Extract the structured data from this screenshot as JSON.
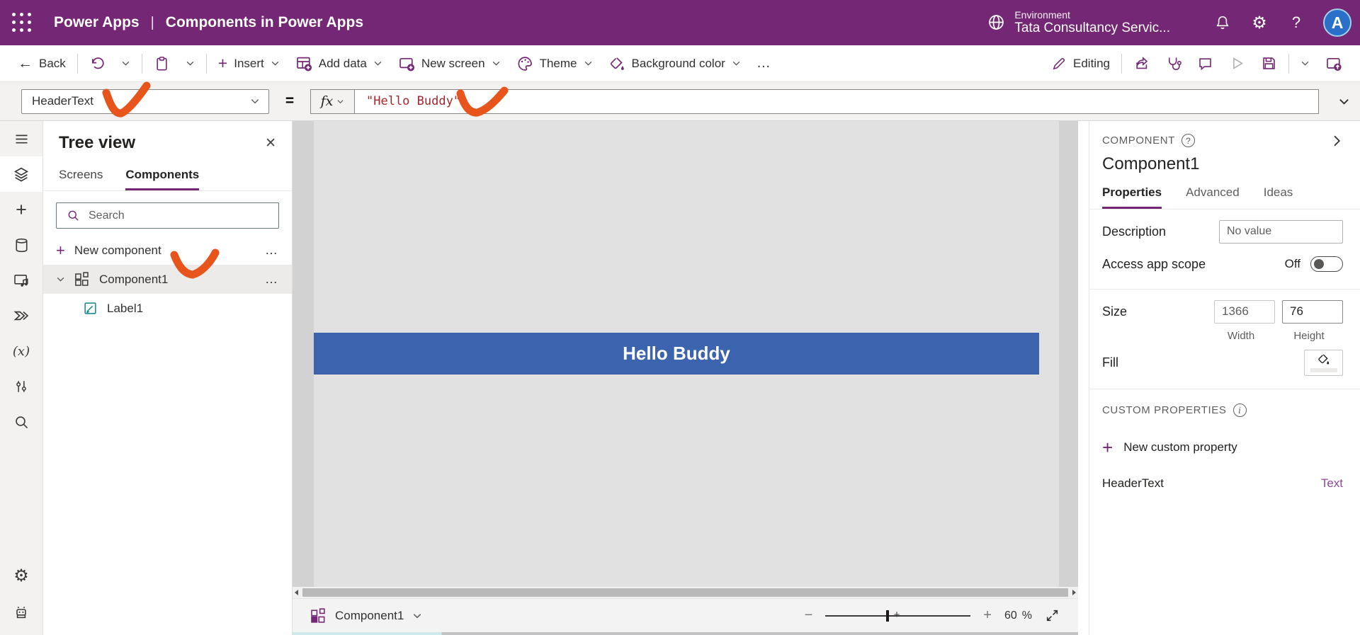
{
  "app": {
    "brand": "Power Apps",
    "title": "Components in Power Apps",
    "environment_label": "Environment",
    "environment_name": "Tata Consultancy Servic...",
    "avatar_initial": "A"
  },
  "glyphs": {
    "back_arrow": "←",
    "plus": "+",
    "ellipsis": "…",
    "minus": "−",
    "close": "✕",
    "gear": "⚙",
    "question_mark": "?",
    "info": "i",
    "pipe": "|",
    "x_variables": "(x)"
  },
  "toolbar": {
    "back": "Back",
    "insert": "Insert",
    "add_data": "Add data",
    "new_screen": "New screen",
    "theme": "Theme",
    "background_color": "Background color",
    "editing": "Editing"
  },
  "formula_bar": {
    "property": "HeaderText",
    "equals": "=",
    "fx": "fx",
    "formula": "\"Hello Buddy\""
  },
  "tree_view": {
    "title": "Tree view",
    "tabs": [
      "Screens",
      "Components"
    ],
    "search_placeholder": "Search",
    "new_component": "New component",
    "component": "Component1",
    "child": "Label1"
  },
  "canvas": {
    "component_text": "Hello Buddy"
  },
  "bottom_bar": {
    "component": "Component1",
    "zoom_value": "60",
    "zoom_unit": "%"
  },
  "right_panel": {
    "header": "COMPONENT",
    "name": "Component1",
    "tabs": [
      "Properties",
      "Advanced",
      "Ideas"
    ],
    "description_label": "Description",
    "description_placeholder": "No value",
    "access_label": "Access app scope",
    "access_state": "Off",
    "size_label": "Size",
    "width_value": "1366",
    "height_value": "76",
    "width_label": "Width",
    "height_label": "Height",
    "fill_label": "Fill",
    "custom_properties_header": "CUSTOM PROPERTIES",
    "new_custom_property": "New custom property",
    "property_name": "HeaderText",
    "property_type": "Text"
  },
  "colors": {
    "brand": "#742774",
    "component_fill": "#3B63AE",
    "formula_text": "#A4262C",
    "annotation": "#E8551C",
    "avatar": "#2A70C8"
  }
}
